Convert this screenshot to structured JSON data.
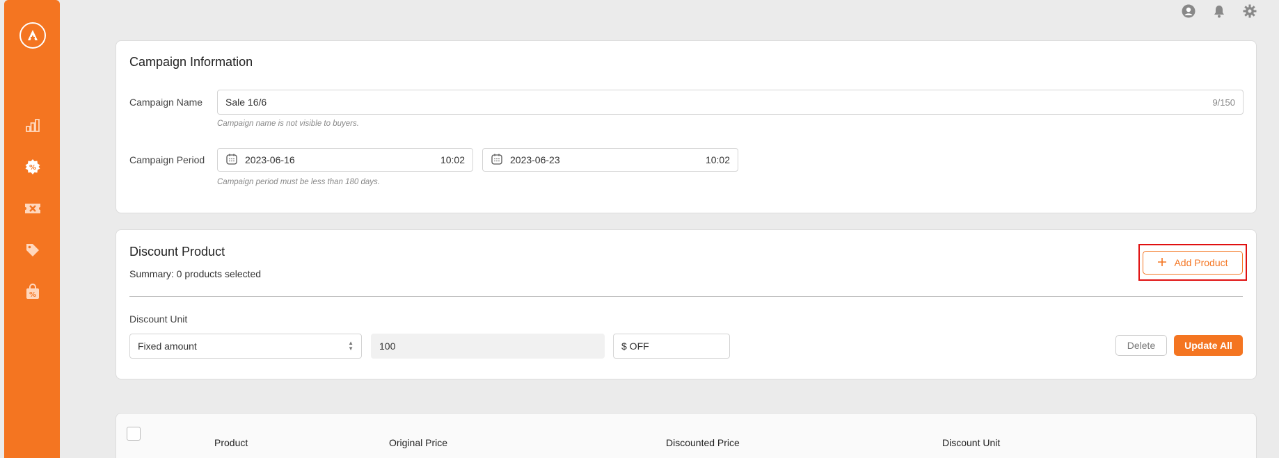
{
  "sidebar": {
    "logo": "logo-icon",
    "items": [
      "chart-icon",
      "discount-badge-icon",
      "voucher-icon",
      "tag-icon",
      "shopping-bag-discount-icon"
    ]
  },
  "topbar": {
    "icons": [
      "user-icon",
      "bell-icon",
      "gear-icon"
    ]
  },
  "campaign_info": {
    "title": "Campaign Information",
    "name_label": "Campaign Name",
    "name_value": "Sale 16/6",
    "name_counter": "9/150",
    "name_hint": "Campaign name is not visible to buyers.",
    "period_label": "Campaign Period",
    "start_date": "2023-06-16",
    "start_time": "10:02",
    "end_date": "2023-06-23",
    "end_time": "10:02",
    "period_hint": "Campaign period must be less than 180 days."
  },
  "discount_product": {
    "title": "Discount Product",
    "summary": "Summary: 0 products selected",
    "add_button": "Add Product",
    "unit_label": "Discount Unit",
    "unit_select": "Fixed amount",
    "amount": "100",
    "suffix": "$ OFF",
    "delete_button": "Delete",
    "update_button": "Update All"
  },
  "table": {
    "headers": [
      "Product",
      "Original Price",
      "Discounted Price",
      "Discount Unit"
    ]
  },
  "colors": {
    "accent": "#f47521",
    "highlight": "#e01010"
  }
}
